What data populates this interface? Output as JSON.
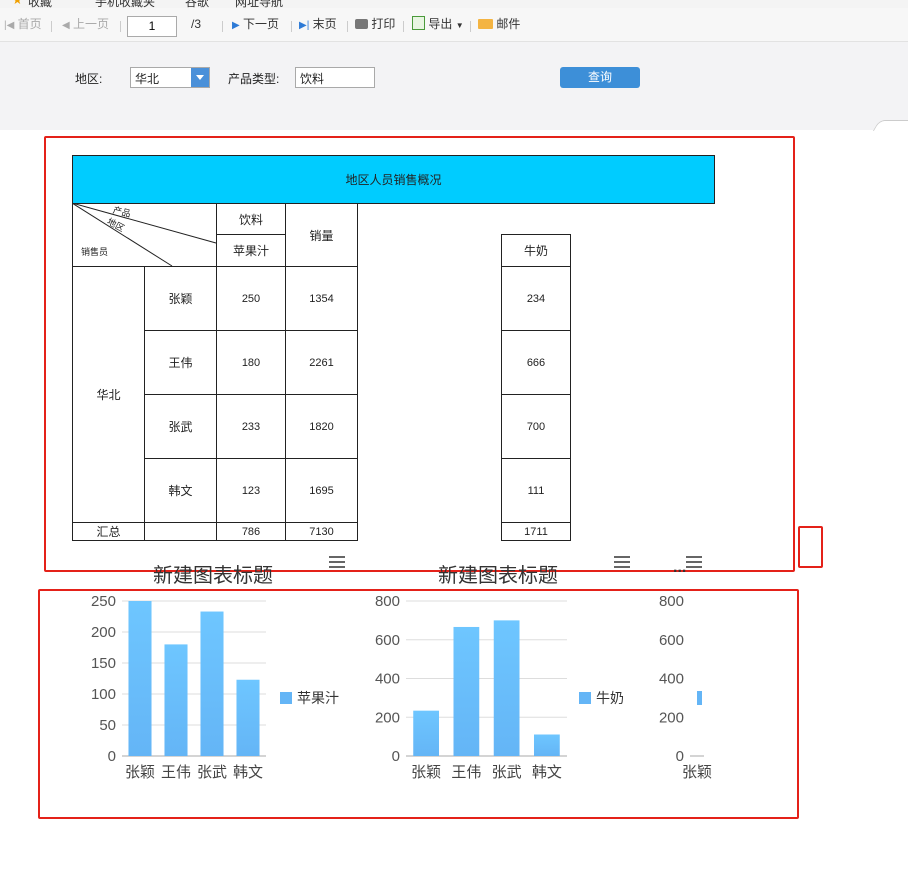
{
  "favorites": [
    "收藏",
    "手机收藏夹",
    "谷歌",
    "网址导航"
  ],
  "toolbar": {
    "first": "首页",
    "prev": "上一页",
    "page_value": "1",
    "page_total": "/3",
    "next": "下一页",
    "last": "末页",
    "print": "打印",
    "export": "导出",
    "mail": "邮件"
  },
  "params": {
    "region_label": "地区:",
    "region_value": "华北",
    "type_label": "产品类型:",
    "type_value": "饮料",
    "query_button": "查询"
  },
  "report": {
    "title": "地区人员销售概况",
    "header_product": "产品",
    "header_region": "地区",
    "header_seller": "销售员",
    "col_category": "饮料",
    "col_juice": "苹果汁",
    "col_sales": "销量",
    "col_milk": "牛奶",
    "region": "华北",
    "rows": [
      {
        "name": "张颖",
        "juice": "250",
        "sales": "1354",
        "milk": "234"
      },
      {
        "name": "王伟",
        "juice": "180",
        "sales": "2261",
        "milk": "666"
      },
      {
        "name": "张武",
        "juice": "233",
        "sales": "1820",
        "milk": "700"
      },
      {
        "name": "韩文",
        "juice": "123",
        "sales": "1695",
        "milk": "111"
      }
    ],
    "total_label": "汇总",
    "total_juice": "786",
    "total_sales": "7130",
    "total_milk": "1711"
  },
  "chart_data": [
    {
      "type": "bar",
      "title": "新建图表标题",
      "categories": [
        "张颖",
        "王伟",
        "张武",
        "韩文"
      ],
      "series": [
        {
          "name": "苹果汁",
          "values": [
            250,
            180,
            233,
            123
          ]
        }
      ],
      "yticks": [
        0,
        50,
        100,
        150,
        200,
        250
      ],
      "ylim": [
        0,
        250
      ],
      "grid": true,
      "legend": "right",
      "color": "#64b5f6"
    },
    {
      "type": "bar",
      "title": "新建图表标题",
      "categories": [
        "张颖",
        "王伟",
        "张武",
        "韩文"
      ],
      "series": [
        {
          "name": "牛奶",
          "values": [
            234,
            666,
            700,
            111
          ]
        }
      ],
      "yticks": [
        0,
        200,
        400,
        600,
        800
      ],
      "ylim": [
        0,
        800
      ],
      "grid": true,
      "legend": "right",
      "color": "#64b5f6"
    },
    {
      "type": "bar",
      "title": "...",
      "categories": [
        "张颖"
      ],
      "series": [
        {
          "values": []
        }
      ],
      "yticks": [
        0,
        200,
        400,
        600,
        800
      ],
      "ylim": [
        0,
        800
      ],
      "grid": false,
      "color": "#64b5f6"
    }
  ]
}
